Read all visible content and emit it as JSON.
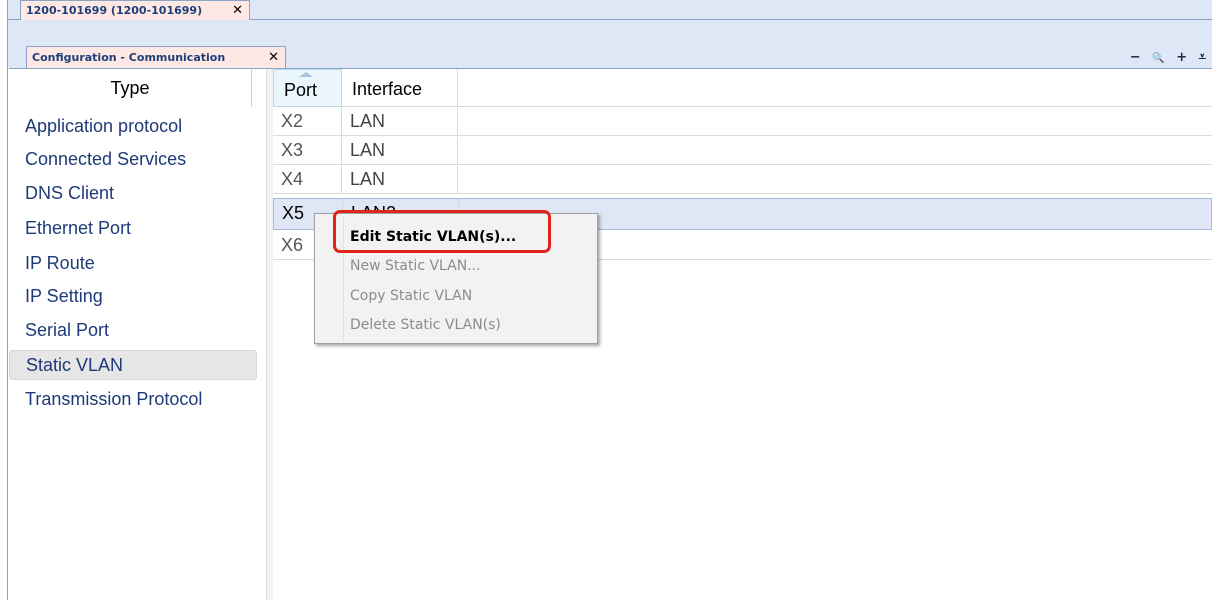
{
  "tabs": {
    "outer": {
      "label": "1200-101699 (1200-101699)",
      "close": "✕"
    },
    "inner": {
      "label": "Configuration - Communication",
      "close": "✕"
    }
  },
  "window_controls": [
    "−",
    "🔍",
    "+",
    "⩡"
  ],
  "type_panel": {
    "header": "Type",
    "items": [
      "Application protocol",
      "Connected Services",
      "DNS Client",
      "Ethernet Port",
      "IP Route",
      "IP Setting",
      "Serial Port",
      "Static VLAN",
      "Transmission Protocol"
    ],
    "selected": "Static VLAN"
  },
  "grid": {
    "columns": [
      "Port",
      "Interface"
    ],
    "rows": [
      {
        "port": "X2",
        "interface": "LAN"
      },
      {
        "port": "X3",
        "interface": "LAN"
      },
      {
        "port": "X4",
        "interface": "LAN"
      },
      {
        "port": "X5",
        "interface": "LAN2"
      },
      {
        "port": "X6",
        "interface": ""
      }
    ],
    "selected_row": "X5"
  },
  "context_menu": {
    "items": [
      {
        "label": "Edit Static VLAN(s)...",
        "enabled": true
      },
      {
        "label": "New Static VLAN...",
        "enabled": false
      },
      {
        "label": "Copy Static VLAN",
        "enabled": false
      },
      {
        "label": "Delete Static VLAN(s)",
        "enabled": false
      }
    ]
  },
  "colors": {
    "tab_background": "#fde8e4",
    "tab_text": "#1e3e7a",
    "list_text": "#1e3a78",
    "selection": "#dfe6f6",
    "highlight": "#e2231a"
  }
}
